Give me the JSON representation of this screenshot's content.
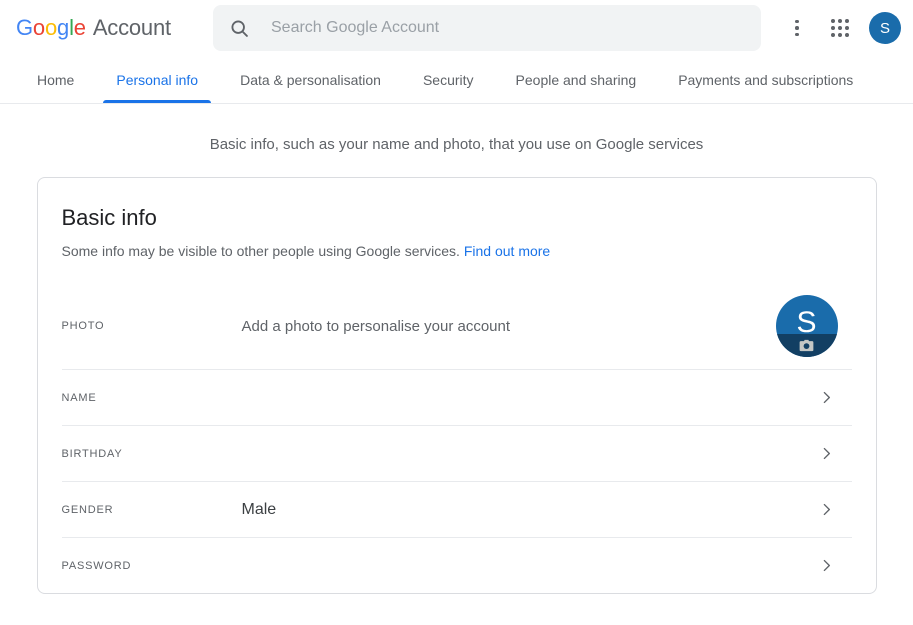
{
  "header": {
    "logo_letters": [
      {
        "ch": "G",
        "color_class": "b"
      },
      {
        "ch": "o",
        "color_class": "r"
      },
      {
        "ch": "o",
        "color_class": "y"
      },
      {
        "ch": "g",
        "color_class": "b"
      },
      {
        "ch": "l",
        "color_class": "g"
      },
      {
        "ch": "e",
        "color_class": "r"
      }
    ],
    "product_word": "Account",
    "search": {
      "placeholder": "Search Google Account",
      "value": "",
      "icon": "search-icon"
    },
    "more_icon": "more-vert-icon",
    "apps_icon": "apps-grid-icon",
    "avatar_initial": "S",
    "avatar_color": "#1a6cab"
  },
  "nav": {
    "tabs": [
      {
        "label": "Home",
        "active": false
      },
      {
        "label": "Personal info",
        "active": true
      },
      {
        "label": "Data & personalisation",
        "active": false
      },
      {
        "label": "Security",
        "active": false
      },
      {
        "label": "People and sharing",
        "active": false
      },
      {
        "label": "Payments and subscriptions",
        "active": false
      }
    ],
    "active_color": "#1a73e8"
  },
  "page": {
    "subtitle": "Basic info, such as your name and photo, that you use on Google services"
  },
  "card": {
    "title": "Basic info",
    "description": "Some info may be visible to other people using Google services.",
    "link_label": "Find out more",
    "link_color": "#1a73e8",
    "rows": [
      {
        "label": "PHOTO",
        "value": "Add a photo to personalise your account",
        "has_avatar": true,
        "has_chevron": false,
        "avatar_initial": "S",
        "avatar_color": "#1a6cab",
        "avatar_band_color": "#123f63",
        "camera_icon": "camera-icon"
      },
      {
        "label": "NAME",
        "value": "",
        "has_avatar": false,
        "has_chevron": true
      },
      {
        "label": "BIRTHDAY",
        "value": "",
        "has_avatar": false,
        "has_chevron": true
      },
      {
        "label": "GENDER",
        "value": "Male",
        "has_avatar": false,
        "has_chevron": true
      },
      {
        "label": "PASSWORD",
        "value": "",
        "has_avatar": false,
        "has_chevron": true
      }
    ]
  }
}
